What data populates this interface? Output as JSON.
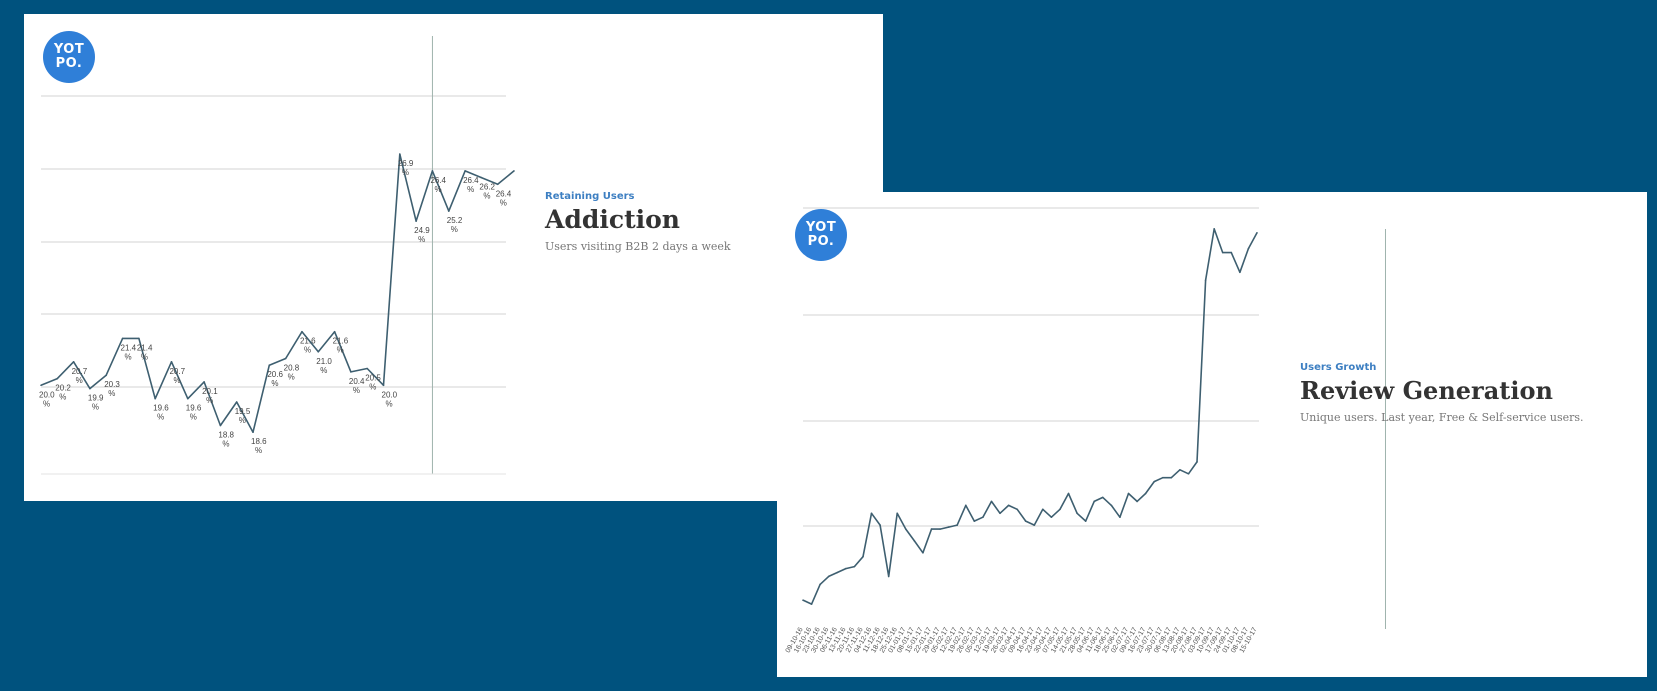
{
  "colors": {
    "background": "#00527e",
    "line": "#3e5f70",
    "grid": "#d3d3d3",
    "logo": "#2f7fd8",
    "kicker": "#3d7fc2"
  },
  "slides": [
    {
      "logo": {
        "line1": "YOT",
        "line2": "PO."
      },
      "kicker": "Retaining Users",
      "title": "Addiction",
      "subtitle": "Users visiting B2B 2 days a week"
    },
    {
      "logo": {
        "line1": "YOT",
        "line2": "PO."
      },
      "kicker": "Users Growth",
      "title": "Review Generation",
      "subtitle": "Unique users. Last year, Free & Self-service users."
    }
  ],
  "chart_data": [
    {
      "type": "line",
      "title": "Addiction",
      "unit": "%",
      "ylim": [
        17.5,
        27.8
      ],
      "grid": true,
      "marker_index": 24,
      "values": [
        20.0,
        20.2,
        20.7,
        19.9,
        20.3,
        21.4,
        21.4,
        19.6,
        20.7,
        19.6,
        20.1,
        18.8,
        19.5,
        18.6,
        20.6,
        20.8,
        21.6,
        21.0,
        21.6,
        20.4,
        20.5,
        20.0,
        26.9,
        24.9,
        26.4,
        25.2,
        26.4,
        26.2,
        26.0,
        26.4
      ],
      "labels": [
        "20.0",
        "20.2",
        "20.7",
        "19.9",
        "20.3",
        "21.4",
        "21.4",
        "19.6",
        "20.7",
        "19.6",
        "20.1",
        "18.8",
        "19.5",
        "18.6",
        "20.6",
        "20.8",
        "21.6",
        "21.0",
        "21.6",
        "20.4",
        "20.5",
        "20.0",
        "26.9",
        "24.9",
        "26.4",
        "25.2",
        "26.4",
        "26.2",
        "26.4"
      ]
    },
    {
      "type": "line",
      "title": "Review Generation",
      "ylim": [
        0,
        100
      ],
      "grid": true,
      "marker_index": 68,
      "values": [
        3,
        2,
        7,
        9,
        10,
        11,
        11.5,
        14,
        25,
        22,
        9,
        25,
        21,
        18,
        15,
        21,
        21,
        21.5,
        22,
        27,
        23,
        24,
        28,
        25,
        27,
        26,
        23,
        22,
        26,
        24,
        26,
        30,
        25,
        23,
        28,
        29,
        27,
        24,
        30,
        28,
        30,
        33,
        34,
        34,
        36,
        35,
        38,
        84,
        97,
        91,
        91,
        86,
        92,
        96
      ],
      "x_tick_labels": [
        "09-10-16",
        "16-10-16",
        "23-10-16",
        "30-10-16",
        "06-11-16",
        "13-11-16",
        "20-11-16",
        "27-11-16",
        "04-12-16",
        "11-12-16",
        "18-12-16",
        "25-12-16",
        "01-01-17",
        "08-01-17",
        "15-01-17",
        "22-01-17",
        "29-01-17",
        "05-02-17",
        "12-02-17",
        "19-02-17",
        "26-02-17",
        "05-03-17",
        "12-03-17",
        "19-03-17",
        "26-03-17",
        "02-04-17",
        "09-04-17",
        "16-04-17",
        "23-04-17",
        "30-04-17",
        "07-05-17",
        "14-05-17",
        "21-05-17",
        "28-05-17",
        "04-06-17",
        "11-06-17",
        "18-06-17",
        "25-06-17",
        "02-07-17",
        "09-07-17",
        "16-07-17",
        "23-07-17",
        "30-07-17",
        "06-08-17",
        "13-08-17",
        "20-08-17",
        "27-08-17",
        "03-09-17",
        "10-09-17",
        "17-09-17",
        "24-09-17",
        "01-10-17",
        "08-10-17",
        "15-10-17"
      ]
    }
  ]
}
